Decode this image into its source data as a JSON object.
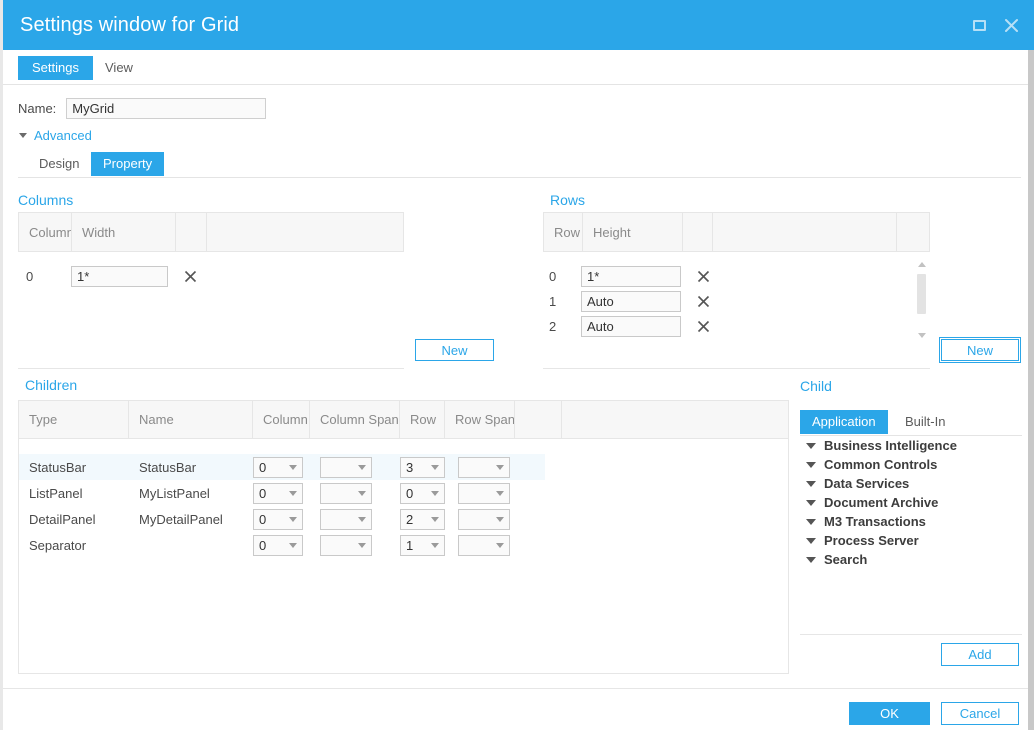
{
  "window": {
    "title": "Settings window for Grid",
    "controls": [
      {
        "name": "maximize",
        "icon": "maximize-icon"
      },
      {
        "name": "close",
        "icon": "close-icon"
      }
    ]
  },
  "tabs": [
    {
      "id": "settings",
      "label": "Settings",
      "active": true
    },
    {
      "id": "view",
      "label": "View",
      "active": false
    }
  ],
  "name_field": {
    "label": "Name:",
    "value": "MyGrid",
    "placeholder": ""
  },
  "advanced": {
    "label": "Advanced",
    "expanded": true
  },
  "subtabs": [
    {
      "id": "design",
      "label": "Design",
      "active": false
    },
    {
      "id": "property",
      "label": "Property",
      "active": true
    }
  ],
  "columns_section": {
    "title": "Columns",
    "headers": [
      "Column",
      "Width",
      "",
      ""
    ],
    "rows": [
      {
        "index": "0",
        "width": "1*"
      }
    ],
    "new_button": "New"
  },
  "rows_section": {
    "title": "Rows",
    "headers": [
      "Row",
      "Height",
      "",
      "",
      ""
    ],
    "rows": [
      {
        "index": "0",
        "height": "1*"
      },
      {
        "index": "1",
        "height": "Auto"
      },
      {
        "index": "2",
        "height": "Auto"
      }
    ],
    "new_button": "New",
    "scrollbar": {
      "up": "scroll-up-arrow",
      "down": "scroll-down-arrow"
    }
  },
  "children_section": {
    "title": "Children",
    "headers": [
      "Type",
      "Name",
      "Column",
      "Column Span",
      "Row",
      "Row Span",
      "",
      ""
    ],
    "rows": [
      {
        "type": "StatusBar",
        "name": "StatusBar",
        "column": "0",
        "column_span": "",
        "row": "3",
        "row_span": "",
        "selected": true
      },
      {
        "type": "ListPanel",
        "name": "MyListPanel",
        "column": "0",
        "column_span": "",
        "row": "0",
        "row_span": "",
        "selected": false
      },
      {
        "type": "DetailPanel",
        "name": "MyDetailPanel",
        "column": "0",
        "column_span": "",
        "row": "2",
        "row_span": "",
        "selected": false
      },
      {
        "type": "Separator",
        "name": "",
        "column": "0",
        "column_span": "",
        "row": "1",
        "row_span": "",
        "selected": false
      }
    ]
  },
  "child_section": {
    "title": "Child",
    "tabs": [
      {
        "id": "application",
        "label": "Application",
        "active": true
      },
      {
        "id": "builtin",
        "label": "Built-In",
        "active": false
      }
    ],
    "tree": [
      {
        "label": "Business Intelligence"
      },
      {
        "label": "Common Controls"
      },
      {
        "label": "Data Services"
      },
      {
        "label": "Document Archive"
      },
      {
        "label": "M3 Transactions"
      },
      {
        "label": "Process Server"
      },
      {
        "label": "Search"
      }
    ],
    "add_button": "Add"
  },
  "footer": {
    "ok": "OK",
    "cancel": "Cancel"
  },
  "colors": {
    "accent": "#2ba6e8",
    "title_bar": "#2ba6e8",
    "selected_row": "#f2f9fd",
    "header_bg": "#f7f7f7",
    "border": "#e6e6e6"
  }
}
